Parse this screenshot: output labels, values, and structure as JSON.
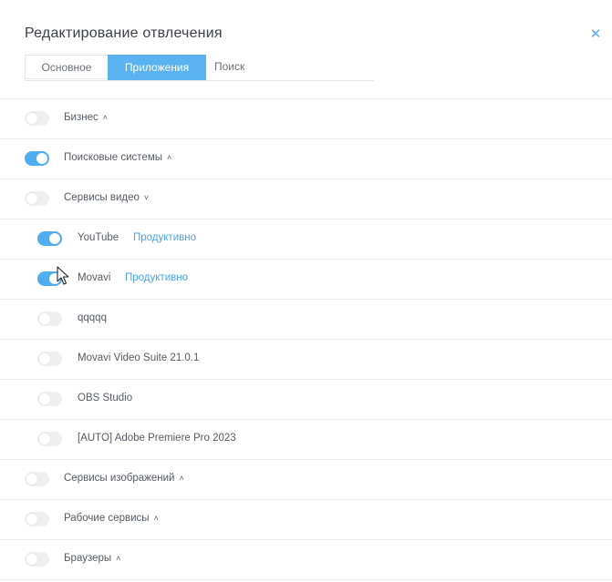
{
  "dialog": {
    "title": "Редактирование отвлечения",
    "close_icon": "close-icon",
    "tabs": [
      {
        "label": "Основное"
      },
      {
        "label": "Приложения",
        "active": true
      },
      {
        "label": "Поиск"
      }
    ]
  },
  "rows": [
    {
      "label": "Бизнес",
      "chevron": "˄",
      "on": false
    },
    {
      "label": "Поисковые системы",
      "chevron": "˄",
      "on": true
    },
    {
      "label": "Сервисы видео",
      "chevron": "˅",
      "on": false
    },
    {
      "label": "YouTube",
      "tag": "Продуктивно",
      "on": true
    },
    {
      "label": "Movavi",
      "tag": "Продуктивно",
      "on": true
    },
    {
      "label": "qqqqq",
      "on": false
    },
    {
      "label": "Movavi Video Suite 21.0.1",
      "on": false
    },
    {
      "label": "OBS Studio",
      "on": false
    },
    {
      "label": "[AUTO] Adobe Premiere Pro 2023",
      "on": false
    },
    {
      "label": "Сервисы изображений",
      "chevron": "˄",
      "on": false
    },
    {
      "label": "Рабочие сервисы",
      "chevron": "˄",
      "on": false
    },
    {
      "label": "Браузеры",
      "chevron": "˄",
      "on": false
    }
  ],
  "colors": {
    "accent": "#4eaef0",
    "tag": "#4aa3e8",
    "toggle_off": "#eeeff1"
  }
}
